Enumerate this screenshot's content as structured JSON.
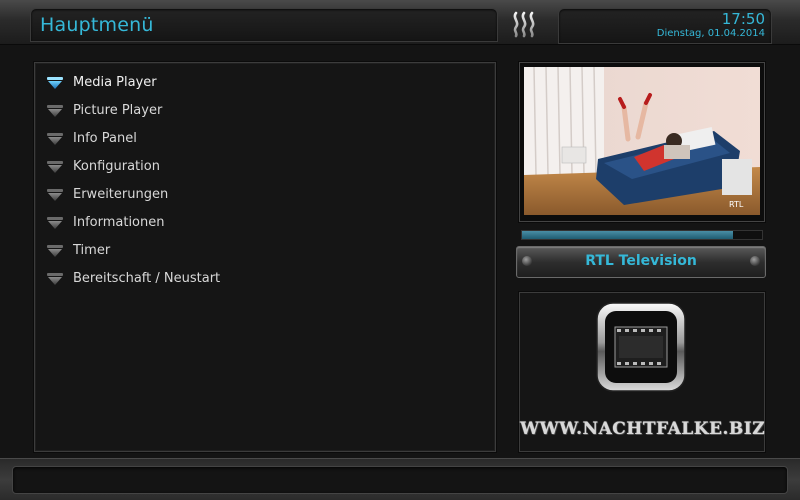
{
  "header": {
    "title": "Hauptmenü",
    "time": "17:50",
    "date": "Dienstag, 01.04.2014"
  },
  "menu": {
    "selected_index": 0,
    "items": [
      {
        "label": "Media Player",
        "icon": "blue-triangle-icon"
      },
      {
        "label": "Picture Player",
        "icon": "gray-triangle-icon"
      },
      {
        "label": "Info Panel",
        "icon": "gray-triangle-icon"
      },
      {
        "label": "Konfiguration",
        "icon": "gray-triangle-icon"
      },
      {
        "label": "Erweiterungen",
        "icon": "gray-triangle-icon"
      },
      {
        "label": "Informationen",
        "icon": "gray-triangle-icon"
      },
      {
        "label": "Timer",
        "icon": "gray-triangle-icon"
      },
      {
        "label": "Bereitschaft / Neustart",
        "icon": "gray-triangle-icon"
      }
    ]
  },
  "player": {
    "channel": "RTL Television",
    "progress_percent": 88
  },
  "branding": {
    "website": "WWW.NACHTFALKE.BIZ"
  },
  "colors": {
    "accent": "#35b8d8",
    "text": "#d8d8d8",
    "background": "#141414"
  }
}
